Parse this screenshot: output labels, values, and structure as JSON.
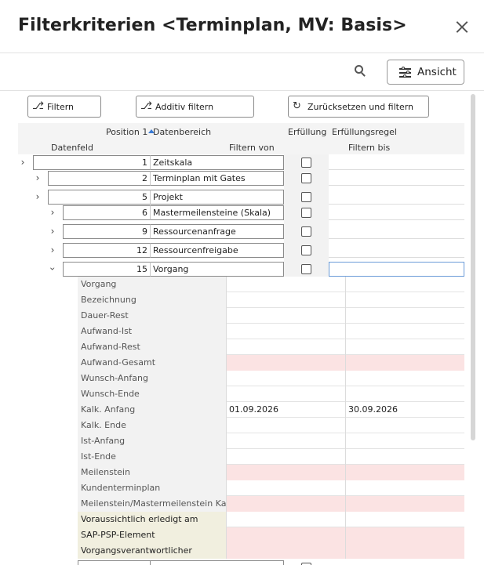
{
  "dialog": {
    "title": "Filterkriterien <Terminplan, MV: Basis>",
    "close_icon": "close-icon"
  },
  "toolbar": {
    "search_icon": "search-icon",
    "view_label": "Ansicht",
    "view_icon": "sliders-icon"
  },
  "actions": {
    "filter_label": "Filtern",
    "filter_icon": "binoculars-icon",
    "additive_label": "Additiv filtern",
    "additive_icon": "binoculars-plus-icon",
    "reset_label": "Zurücksetzen und filtern",
    "reset_icon": "refresh-icon"
  },
  "headers": {
    "position": "Position 1",
    "datenbereich": "Datenbereich",
    "erfuellung": "Erfüllung",
    "erfuellungsregel": "Erfüllungsregel",
    "datenfeld": "Datenfeld",
    "filtern_von": "Filtern von",
    "filtern_bis": "Filtern bis"
  },
  "tree_rows": [
    {
      "position": "1",
      "label": "Zeitskala",
      "expanded": false
    },
    {
      "position": "2",
      "label": "Terminplan mit Gates",
      "expanded": false
    },
    {
      "position": "5",
      "label": "Projekt",
      "expanded": false
    },
    {
      "position": "6",
      "label": "Mastermeilensteine (Skala)",
      "expanded": false
    },
    {
      "position": "9",
      "label": "Ressourcenanfrage",
      "expanded": false
    },
    {
      "position": "12",
      "label": "Ressourcenfreigabe",
      "expanded": false
    },
    {
      "position": "15",
      "label": "Vorgang",
      "expanded": true
    }
  ],
  "fields": [
    {
      "name": "Vorgang",
      "von": "",
      "bis": "",
      "style": ""
    },
    {
      "name": "Bezeichnung",
      "von": "",
      "bis": "",
      "style": ""
    },
    {
      "name": "Dauer-Rest",
      "von": "",
      "bis": "",
      "style": ""
    },
    {
      "name": "Aufwand-Ist",
      "von": "",
      "bis": "",
      "style": ""
    },
    {
      "name": "Aufwand-Rest",
      "von": "",
      "bis": "",
      "style": ""
    },
    {
      "name": "Aufwand-Gesamt",
      "von": "",
      "bis": "",
      "style": "pink"
    },
    {
      "name": "Wunsch-Anfang",
      "von": "",
      "bis": "",
      "style": ""
    },
    {
      "name": "Wunsch-Ende",
      "von": "",
      "bis": "",
      "style": ""
    },
    {
      "name": "Kalk. Anfang",
      "von": "01.09.2026",
      "bis": "30.09.2026",
      "style": ""
    },
    {
      "name": "Kalk. Ende",
      "von": "",
      "bis": "",
      "style": ""
    },
    {
      "name": "Ist-Anfang",
      "von": "",
      "bis": "",
      "style": ""
    },
    {
      "name": "Ist-Ende",
      "von": "",
      "bis": "",
      "style": ""
    },
    {
      "name": "Meilenstein",
      "von": "",
      "bis": "",
      "style": "pink"
    },
    {
      "name": "Kundenterminplan",
      "von": "",
      "bis": "",
      "style": ""
    },
    {
      "name": "Meilenstein/Mastermeilenstein Kalk...",
      "von": "",
      "bis": "",
      "style": "pink"
    },
    {
      "name": "Voraussichtlich erledigt am",
      "von": "",
      "bis": "",
      "style": "yellow-label"
    },
    {
      "name": "SAP-PSP-Element",
      "von": "",
      "bis": "",
      "style": "yellow-pink"
    },
    {
      "name": "Vorgangsverantwortlicher",
      "von": "",
      "bis": "",
      "style": "yellow-pink"
    }
  ],
  "colors": {
    "accent": "#3a7bd5",
    "mandatory_pink": "#fbe3e3",
    "custom_field_yellow": "#f1efdf"
  }
}
